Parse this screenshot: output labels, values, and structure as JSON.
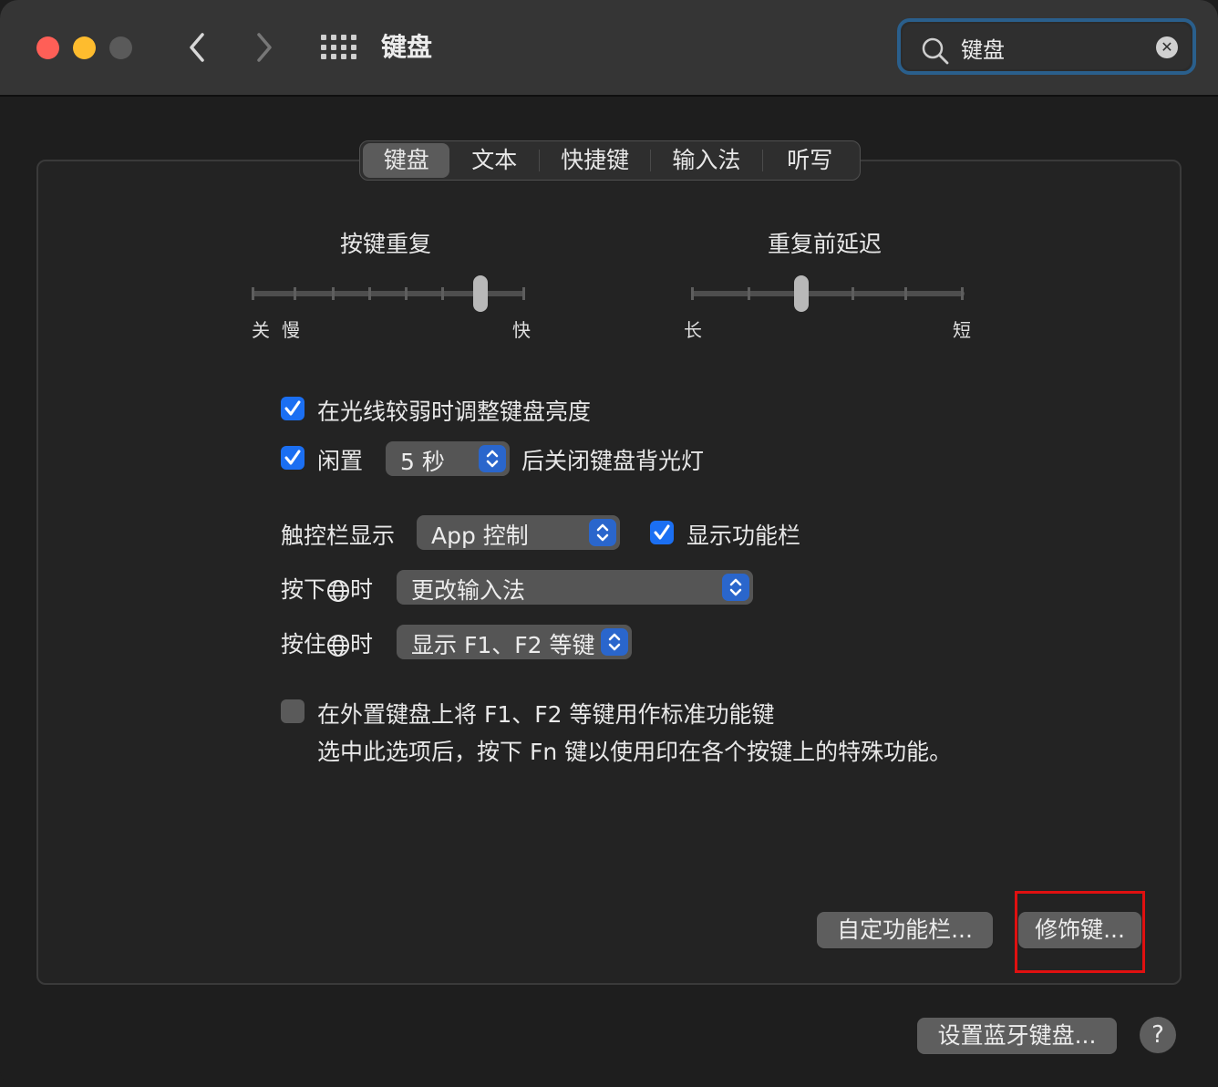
{
  "window": {
    "title": "键盘"
  },
  "search": {
    "value": "键盘"
  },
  "tabs": [
    {
      "label": "键盘",
      "active": true
    },
    {
      "label": "文本",
      "active": false
    },
    {
      "label": "快捷键",
      "active": false
    },
    {
      "label": "输入法",
      "active": false
    },
    {
      "label": "听写",
      "active": false
    }
  ],
  "key_repeat": {
    "label": "按键重复",
    "min_label": "关",
    "slow_label": "慢",
    "max_label": "快",
    "ticks": 8,
    "value_index": 6
  },
  "delay_until_repeat": {
    "label": "重复前延迟",
    "min_label": "长",
    "max_label": "短",
    "ticks": 6,
    "value_index": 2
  },
  "options": {
    "adjust_brightness": {
      "label": "在光线较弱时调整键盘亮度",
      "checked": true
    },
    "idle": {
      "prefix": "闲置",
      "value": "5 秒",
      "suffix": "后关闭键盘背光灯",
      "checked": true
    },
    "touchbar": {
      "label": "触控栏显示",
      "value": "App 控制"
    },
    "show_fn_strip": {
      "label": "显示功能栏",
      "checked": true
    },
    "press_globe": {
      "prefix": "按下",
      "suffix": "时",
      "value": "更改输入法"
    },
    "hold_globe": {
      "prefix": "按住",
      "suffix": "时",
      "value": "显示 F1、F2 等键"
    },
    "fn_keys": {
      "label": "在外置键盘上将 F1、F2 等键用作标准功能键",
      "description": "选中此选项后，按下 Fn 键以使用印在各个按键上的特殊功能。",
      "checked": false
    }
  },
  "buttons": {
    "customize_touchbar": "自定功能栏...",
    "modifier_keys": "修饰键...",
    "bluetooth_keyboard": "设置蓝牙键盘...",
    "help": "?"
  },
  "colors": {
    "accent": "#1b6ff2",
    "highlight": "#e01010",
    "close": "#ff5f57",
    "minimize": "#febc2e"
  }
}
